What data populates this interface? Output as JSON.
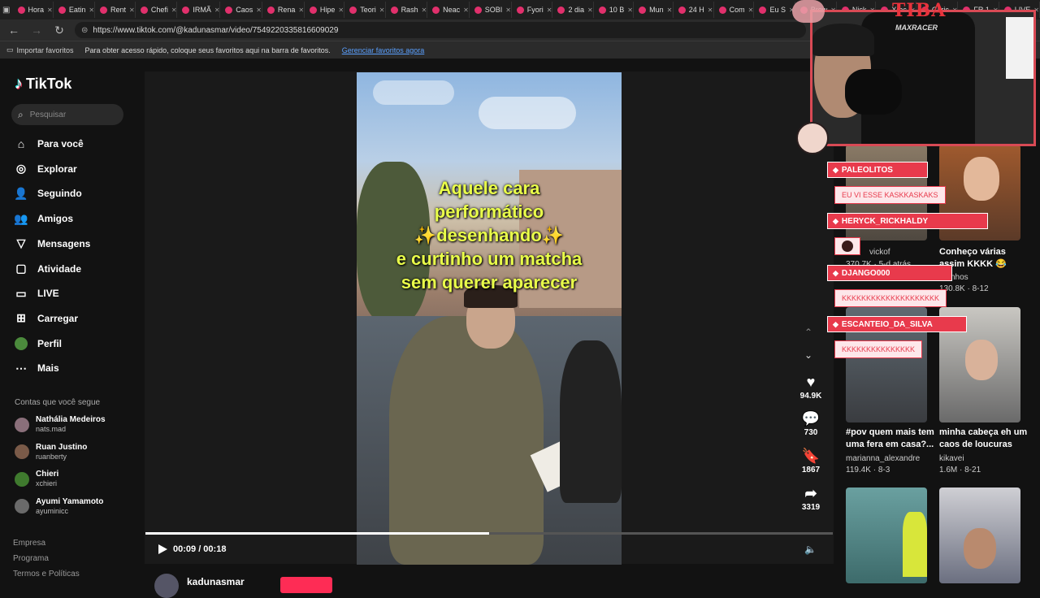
{
  "browser": {
    "tabs": [
      "Hora",
      "Eatin",
      "Rent",
      "Chefi",
      "IRMÃ",
      "Caos",
      "Rena",
      "Hipe",
      "Teori",
      "Rash",
      "Neac",
      "SOBI",
      "Fyori",
      "2 dia",
      "10 B",
      "Mun",
      "24 H",
      "Com",
      "Eu S",
      "Brow",
      "Nick",
      "Xrac",
      "Caric",
      "FR 1",
      "LIVE"
    ],
    "url": "https://www.tiktok.com/@kadunasmar/video/7549220335816609029",
    "bookmarks": {
      "import": "Importar favoritos",
      "hint": "Para obter acesso rápido, coloque seus favoritos aqui na barra de favoritos.",
      "manage": "Gerenciar favoritos agora"
    }
  },
  "sidebar": {
    "logo": "TikTok",
    "search_placeholder": "Pesquisar",
    "nav": [
      {
        "label": "Para você",
        "icon": "home-icon"
      },
      {
        "label": "Explorar",
        "icon": "compass-icon"
      },
      {
        "label": "Seguindo",
        "icon": "following-icon"
      },
      {
        "label": "Amigos",
        "icon": "friends-icon"
      },
      {
        "label": "Mensagens",
        "icon": "messages-icon"
      },
      {
        "label": "Atividade",
        "icon": "activity-icon"
      },
      {
        "label": "LIVE",
        "icon": "live-icon"
      },
      {
        "label": "Carregar",
        "icon": "upload-icon"
      },
      {
        "label": "Perfil",
        "icon": "profile-icon"
      },
      {
        "label": "Mais",
        "icon": "more-icon"
      }
    ],
    "following_title": "Contas que você segue",
    "accounts": [
      {
        "name": "Nathália Medeiros",
        "handle": "nats.mad"
      },
      {
        "name": "Ruan Justino",
        "handle": "ruanberty"
      },
      {
        "name": "Chieri",
        "handle": "xchieri"
      },
      {
        "name": "Ayumi Yamamoto",
        "handle": "ayuminicc"
      }
    ],
    "footer": [
      "Empresa",
      "Programa",
      "Termos e Políticas"
    ]
  },
  "video": {
    "caption_lines": [
      "Aquele cara",
      "performático",
      "✨desenhando✨",
      "e curtinho um matcha",
      "sem querer aparecer"
    ],
    "time": "00:09 / 00:18",
    "progress": 0.5,
    "author": "kadunasmar"
  },
  "actions": {
    "likes": "94.9K",
    "comments": "730",
    "saves": "1867",
    "shares": "3319"
  },
  "feed": [
    {
      "caption": "",
      "author": "vickof",
      "stats": "370.7K · 5-d atrás"
    },
    {
      "caption": "Conheço várias assim KKKK 😂",
      "author": "nhos",
      "stats": "130.8K · 8-12"
    },
    {
      "caption": "#pov quem mais tem uma fera em casa?...",
      "author": "marianna_alexandre",
      "stats": "119.4K · 8-3"
    },
    {
      "caption": "minha cabeça eh um caos de loucuras",
      "author": "kikavei",
      "stats": "1.6M · 8-21"
    }
  ],
  "stream": {
    "title": "TIBA",
    "cam_brand": "MAXRACER",
    "chat": [
      {
        "name": "PALEOLITOS",
        "message": "EU VI ESSE KASKKASKAKS"
      },
      {
        "name": "HERYCK_RICKHALDY",
        "message": ""
      },
      {
        "name": "DJANGO000",
        "message": "KKKKKKKKKKKKKKKKKKKK"
      },
      {
        "name": "ESCANTEIO_DA_SILVA",
        "message": "KKKKKKKKKKKKKKK"
      }
    ]
  },
  "colors": {
    "accent": "#e83a4c",
    "caption": "#eaff4a"
  }
}
